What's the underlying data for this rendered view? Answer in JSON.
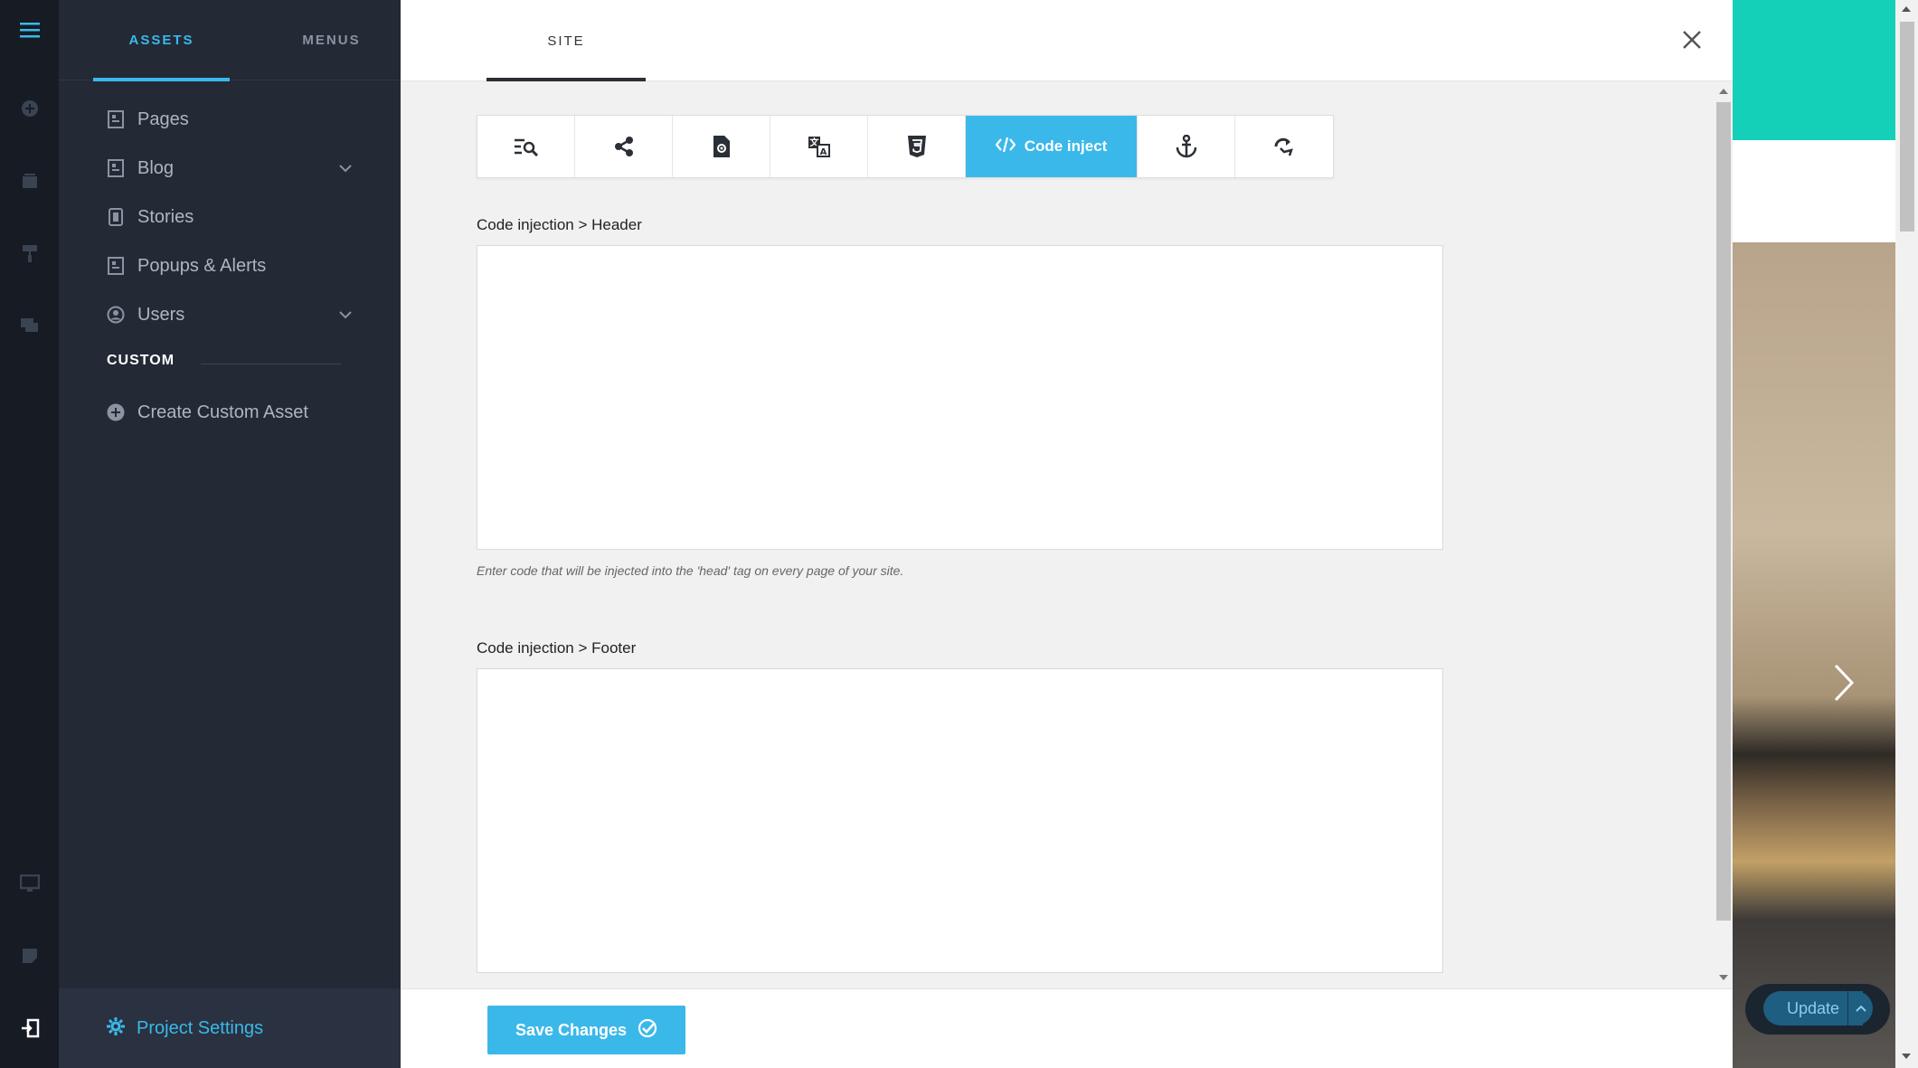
{
  "sidebar": {
    "tabs": [
      {
        "label": "ASSETS",
        "active": true
      },
      {
        "label": "MENUS",
        "active": false
      }
    ],
    "items": [
      {
        "label": "Pages",
        "icon": "page-icon"
      },
      {
        "label": "Blog",
        "icon": "page-icon",
        "expandable": true
      },
      {
        "label": "Stories",
        "icon": "phone-page-icon"
      },
      {
        "label": "Popups & Alerts",
        "icon": "page-icon"
      },
      {
        "label": "Users",
        "icon": "user-circle-icon",
        "expandable": true
      }
    ],
    "section_label": "CUSTOM",
    "create_label": "Create Custom Asset",
    "footer_label": "Project Settings"
  },
  "main": {
    "tab_label": "SITE",
    "toolbar": {
      "active_label": "Code inject"
    },
    "header_label": "Code injection > Header",
    "header_hint": "Enter code that will be injected into the 'head' tag on every page of your site.",
    "footer_label": "Code injection > Footer",
    "save_label": "Save Changes"
  },
  "preview": {
    "update_label": "Update"
  },
  "colors": {
    "accent": "#3bb8ea",
    "teal": "#14d0b8",
    "sidebar_bg": "#232a36",
    "rail_bg": "#161b24"
  }
}
